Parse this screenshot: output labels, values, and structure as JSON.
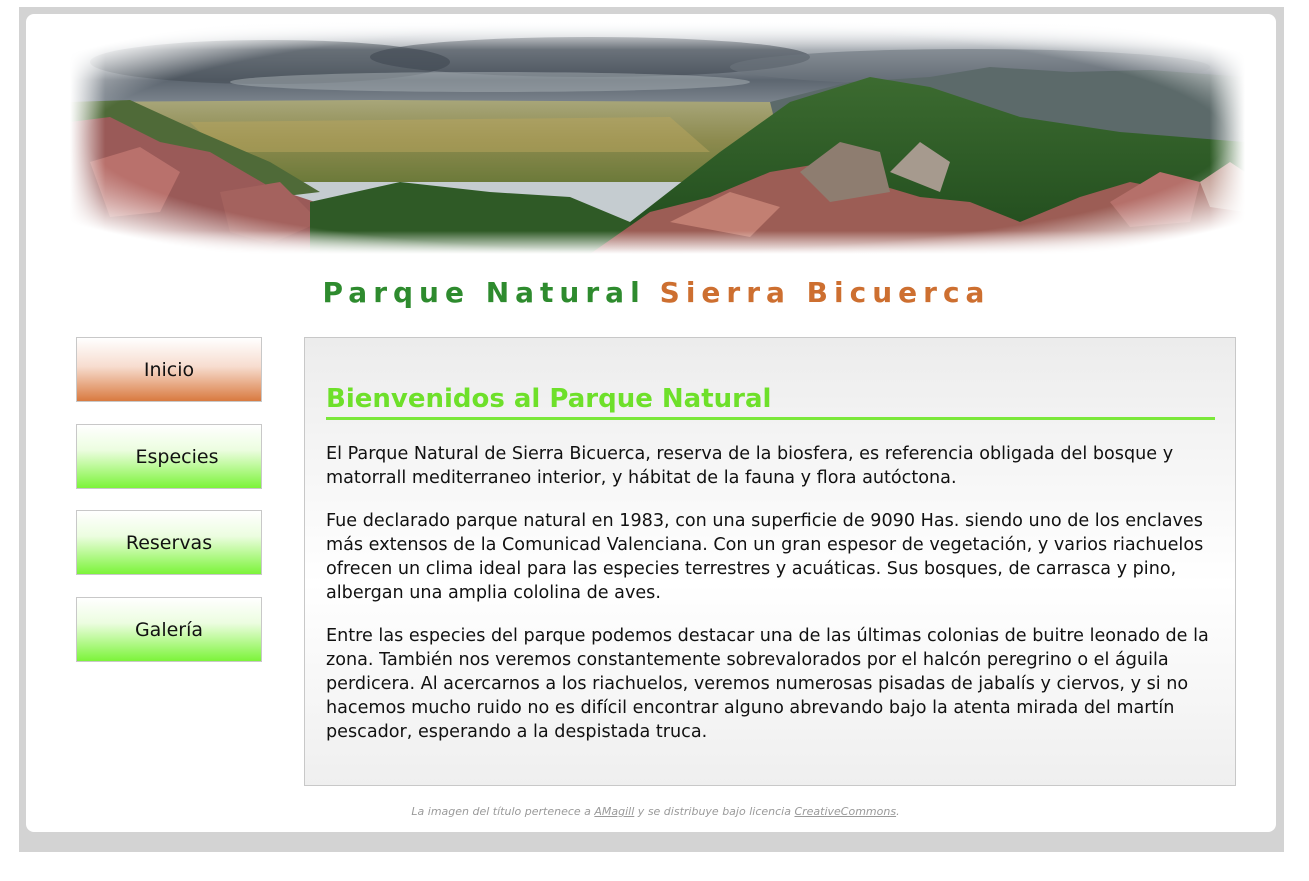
{
  "header": {
    "banner_alt": "mountain-landscape-banner",
    "title_part1": "Parque Natural",
    "title_part2": "Sierra Bicuerca"
  },
  "nav": {
    "items": [
      {
        "label": "Inicio",
        "active": true
      },
      {
        "label": "Especies",
        "active": false
      },
      {
        "label": "Reservas",
        "active": false
      },
      {
        "label": "Galería",
        "active": false
      }
    ]
  },
  "main": {
    "heading": "Bienvenidos al Parque Natural",
    "paragraphs": [
      "El Parque Natural de Sierra Bicuerca, reserva de la biosfera, es referencia obligada del bosque y matorrall mediterraneo interior, y hábitat de la fauna y flora autóctona.",
      "Fue declarado parque natural en 1983, con una superficie de 9090 Has. siendo uno de los enclaves más extensos de la Comunicad Valenciana. Con un gran espesor de vegetación, y varios riachuelos ofrecen un clima ideal para las especies terrestres y acuáticas. Sus bosques, de carrasca y pino, albergan una amplia cololina de aves.",
      "Entre las especies del parque podemos destacar una de las últimas colonias de buitre leonado de la zona. También nos veremos constantemente sobrevalorados por el halcón peregrino o el águila perdicera. Al acercarnos a los riachuelos, veremos numerosas pisadas de jabalís y ciervos, y si no hacemos mucho ruido no es difícil encontrar alguno abrevando bajo la atenta mirada del martín pescador, esperando a la despistada truca."
    ]
  },
  "footer": {
    "text_before": "La imagen del título pertenece a ",
    "author_link": "AMagill",
    "text_middle": " y se distribuye bajo licencia ",
    "license_link": "CreativeCommons",
    "text_after": "."
  },
  "colors": {
    "title_green": "#2e8b2e",
    "title_orange": "#cd6f30",
    "heading_green": "#6ee02a",
    "nav_active": "#d97a40",
    "nav_normal": "#7cf43a"
  }
}
